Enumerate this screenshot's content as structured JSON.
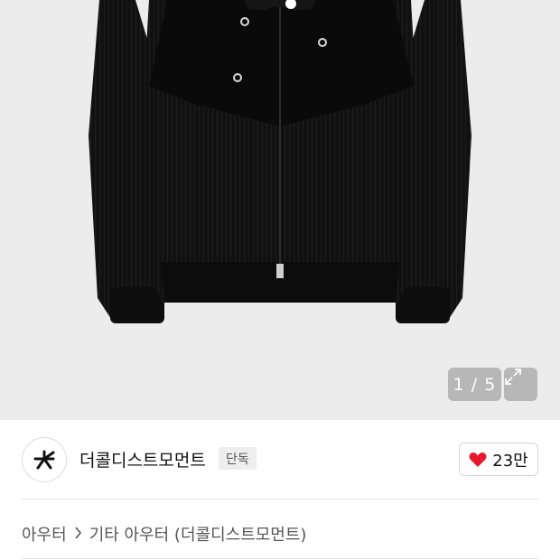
{
  "gallery": {
    "image_alt": "black corduroy zip-up jacket",
    "current_page": "1",
    "total_pages": "5",
    "pager_text": "1 / 5",
    "expand_icon": "expand-icon"
  },
  "brand": {
    "logo_icon": "star-logo-icon",
    "name": "더콜디스트모먼트",
    "badge": "단독"
  },
  "likes": {
    "icon": "heart-icon",
    "count": "23만",
    "color": "#e8192c"
  },
  "breadcrumb": {
    "items": [
      "아우터",
      "기타 아우터 (더콜디스트모먼트)"
    ],
    "separator_icon": "chevron-right-icon"
  }
}
